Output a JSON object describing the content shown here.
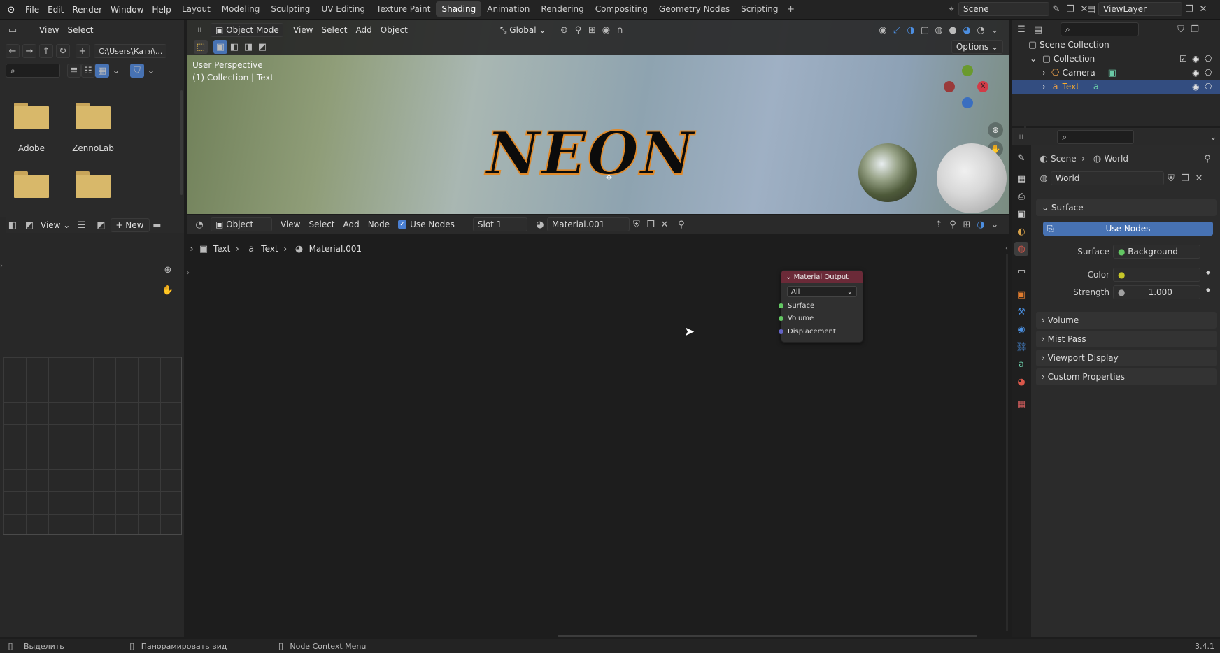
{
  "menu": {
    "items": [
      "File",
      "Edit",
      "Render",
      "Window",
      "Help"
    ]
  },
  "workspaces": [
    "Layout",
    "Modeling",
    "Sculpting",
    "UV Editing",
    "Texture Paint",
    "Shading",
    "Animation",
    "Rendering",
    "Compositing",
    "Geometry Nodes",
    "Scripting"
  ],
  "active_workspace": "Shading",
  "scene": {
    "name": "Scene",
    "view_layer": "ViewLayer"
  },
  "filebrowser": {
    "view": "View",
    "select": "Select",
    "path": "C:\\Users\\Катя\\...",
    "folders": [
      "Adobe",
      "ZennoLab",
      "",
      ""
    ]
  },
  "viewport": {
    "mode": "Object Mode",
    "menus": [
      "View",
      "Select",
      "Add",
      "Object"
    ],
    "orientation": "Global",
    "options": "Options",
    "overlay_line1": "User Perspective",
    "overlay_line2": "(1) Collection | Text",
    "text_object": "NEON"
  },
  "imageeditor": {
    "view": "View",
    "new": "New"
  },
  "nodeeditor": {
    "type": "Object",
    "menus": [
      "View",
      "Select",
      "Add",
      "Node"
    ],
    "use_nodes": "Use Nodes",
    "slot": "Slot 1",
    "material": "Material.001",
    "breadcrumb": [
      "Text",
      "Text",
      "Material.001"
    ],
    "node": {
      "title": "Material Output",
      "target": "All",
      "sockets": [
        "Surface",
        "Volume",
        "Displacement"
      ]
    }
  },
  "outliner": {
    "root": "Scene Collection",
    "collection": "Collection",
    "items": [
      "Camera",
      "Text"
    ]
  },
  "properties": {
    "breadcrumb": [
      "Scene",
      "World"
    ],
    "world_name": "World",
    "surface_section": "Surface",
    "use_nodes": "Use Nodes",
    "surface_label": "Surface",
    "surface_value": "Background",
    "color_label": "Color",
    "strength_label": "Strength",
    "strength_value": "1.000",
    "sections": [
      "Volume",
      "Mist Pass",
      "Viewport Display",
      "Custom Properties"
    ]
  },
  "statusbar": {
    "items": [
      "Выделить",
      "Панорамировать вид",
      "Node Context Menu"
    ],
    "version": "3.4.1"
  }
}
